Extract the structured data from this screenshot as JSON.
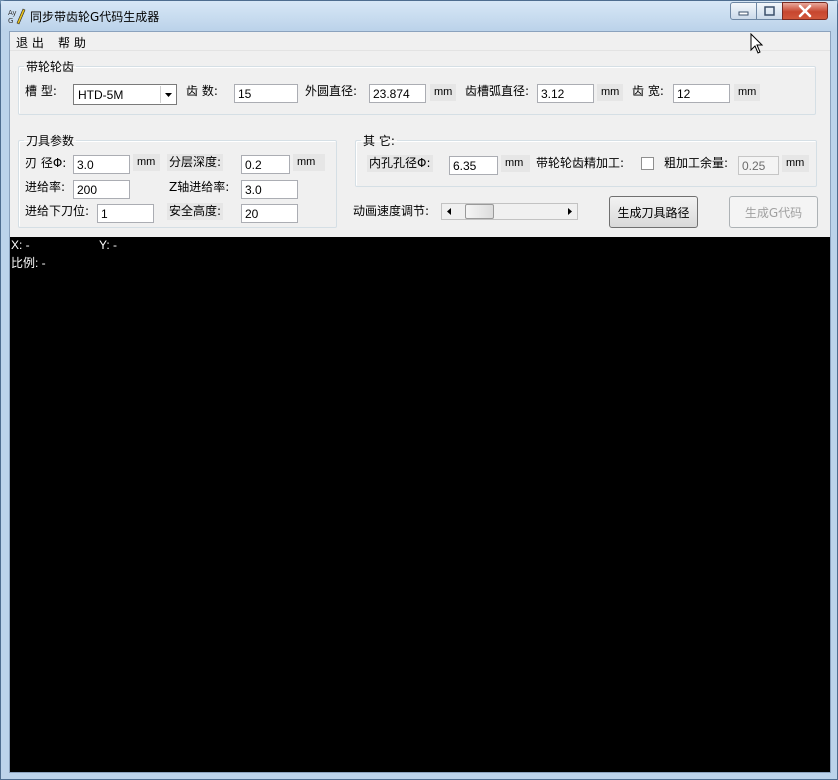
{
  "window": {
    "title": "同步带齿轮G代码生成器",
    "icon_name": "app-logo-icon",
    "controls": [
      "minimize-icon",
      "maximize-icon",
      "close-icon"
    ]
  },
  "menu": {
    "items": [
      "退 出",
      "帮 助"
    ]
  },
  "pulley_group": {
    "title": "带轮轮齿",
    "groove_type_label": "槽 型:",
    "groove_type_value": "HTD-5M",
    "teeth_label": "齿 数:",
    "teeth_value": "15",
    "outer_dia_label": "外圆直径:",
    "outer_dia_value": "23.874",
    "outer_dia_unit": "mm",
    "arc_dia_label": "齿槽弧直径:",
    "arc_dia_value": "3.12",
    "arc_dia_unit": "mm",
    "width_label": "齿 宽:",
    "width_value": "12",
    "width_unit": "mm"
  },
  "tool_group": {
    "title": "刀具参数",
    "blade_dia_label": "刃 径Φ:",
    "blade_dia_value": "3.0",
    "blade_dia_unit": "mm",
    "layer_depth_label": "分层深度:",
    "layer_depth_value": "0.2",
    "layer_depth_unit": "mm",
    "feed_rate_label": "进给率:",
    "feed_rate_value": "200",
    "z_feed_label": "Z轴进给率:",
    "z_feed_value": "3.0",
    "plunge_label": "进给下刀位:",
    "plunge_value": "1",
    "safe_height_label": "安全高度:",
    "safe_height_value": "20"
  },
  "other_group": {
    "title": "其 它:",
    "bore_label": "内孔孔径Φ:",
    "bore_value": "6.35",
    "bore_unit": "mm",
    "finish_label": "带轮轮齿精加工:",
    "finish_checked": false,
    "allowance_label": "粗加工余量:",
    "allowance_value": "0.25",
    "allowance_unit": "mm"
  },
  "controls": {
    "speed_label": "动画速度调节:",
    "speed_fraction": 0.1,
    "gen_path_button": "生成刀具路径",
    "gen_gcode_button": "生成G代码"
  },
  "canvas": {
    "x_readout": "X: -",
    "y_readout": "Y: -",
    "scale_readout": "比例: -"
  },
  "colors": {
    "canvas_bg": "#000000",
    "canvas_text": "#ffffff",
    "close_button": "#c7462f"
  }
}
